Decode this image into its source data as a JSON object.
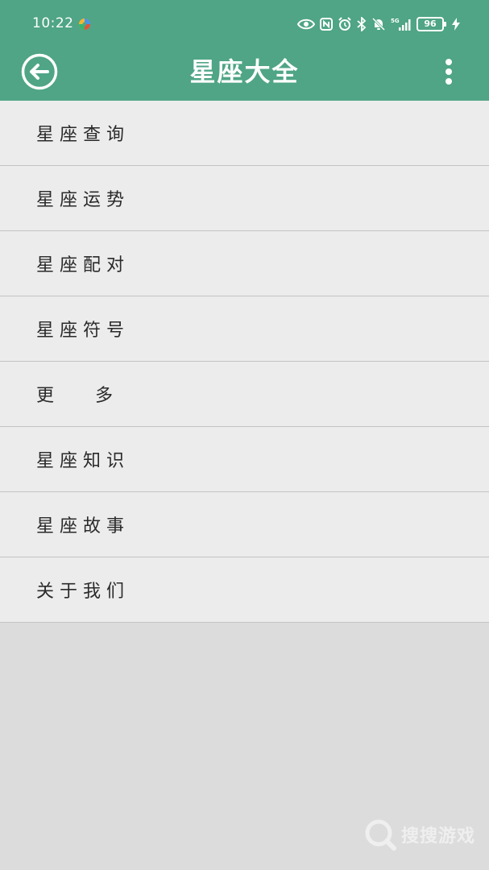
{
  "status_bar": {
    "time": "10:22",
    "battery": "96",
    "network_label": "5G"
  },
  "app_bar": {
    "title": "星座大全"
  },
  "menu": {
    "items": [
      {
        "label": "星座查询"
      },
      {
        "label": "星座运势"
      },
      {
        "label": "星座配对"
      },
      {
        "label": "星座符号"
      },
      {
        "label": "更 多"
      },
      {
        "label": "星座知识"
      },
      {
        "label": "星座故事"
      },
      {
        "label": "关于我们"
      }
    ]
  },
  "watermark": {
    "text": "搜搜游戏"
  },
  "colors": {
    "primary": "#4fa585",
    "list_background": "#ececec",
    "divider": "#c3c3c3",
    "page_background": "#dcdcdc"
  }
}
